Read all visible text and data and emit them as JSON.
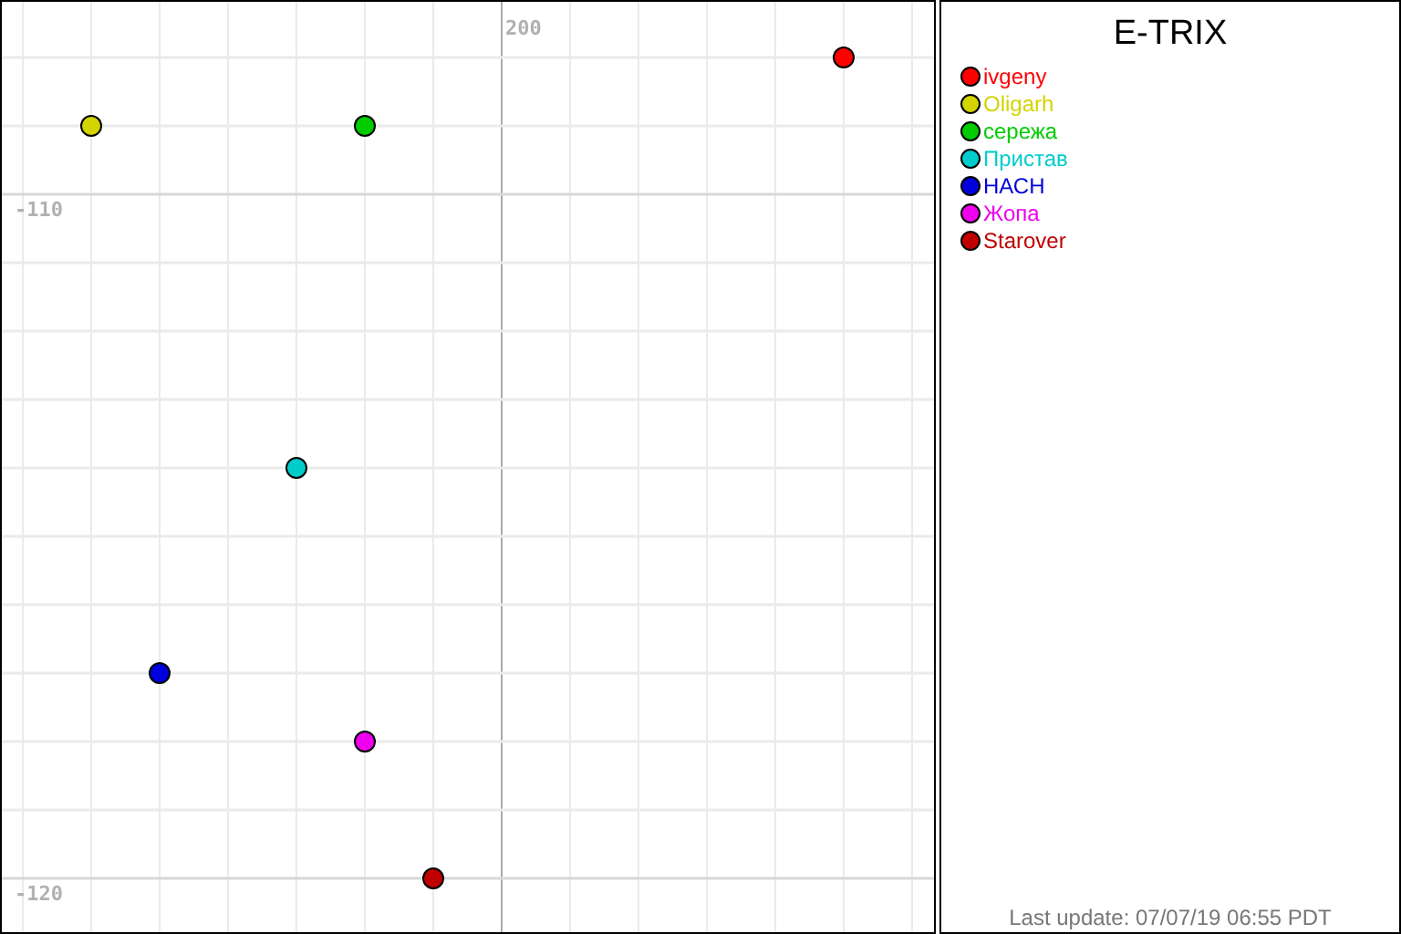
{
  "map": {
    "grid_labels": [
      {
        "text": "200",
        "kind": "column"
      },
      {
        "text": "-110",
        "kind": "row"
      },
      {
        "text": "-120",
        "kind": "row"
      }
    ]
  },
  "legend": {
    "title": "E-TRIX",
    "players": [
      {
        "name": "ivgeny",
        "color": "#ff0000"
      },
      {
        "name": "Oligarh",
        "color": "#d4d400"
      },
      {
        "name": "сережа",
        "color": "#00cc00"
      },
      {
        "name": "Пристав",
        "color": "#00cccc"
      },
      {
        "name": "НАСН",
        "color": "#0000dd"
      },
      {
        "name": "Жопа",
        "color": "#ee00ee"
      },
      {
        "name": "Starover",
        "color": "#c00000"
      }
    ]
  },
  "status": "Last update: 07/07/19 06:55 PDT"
}
